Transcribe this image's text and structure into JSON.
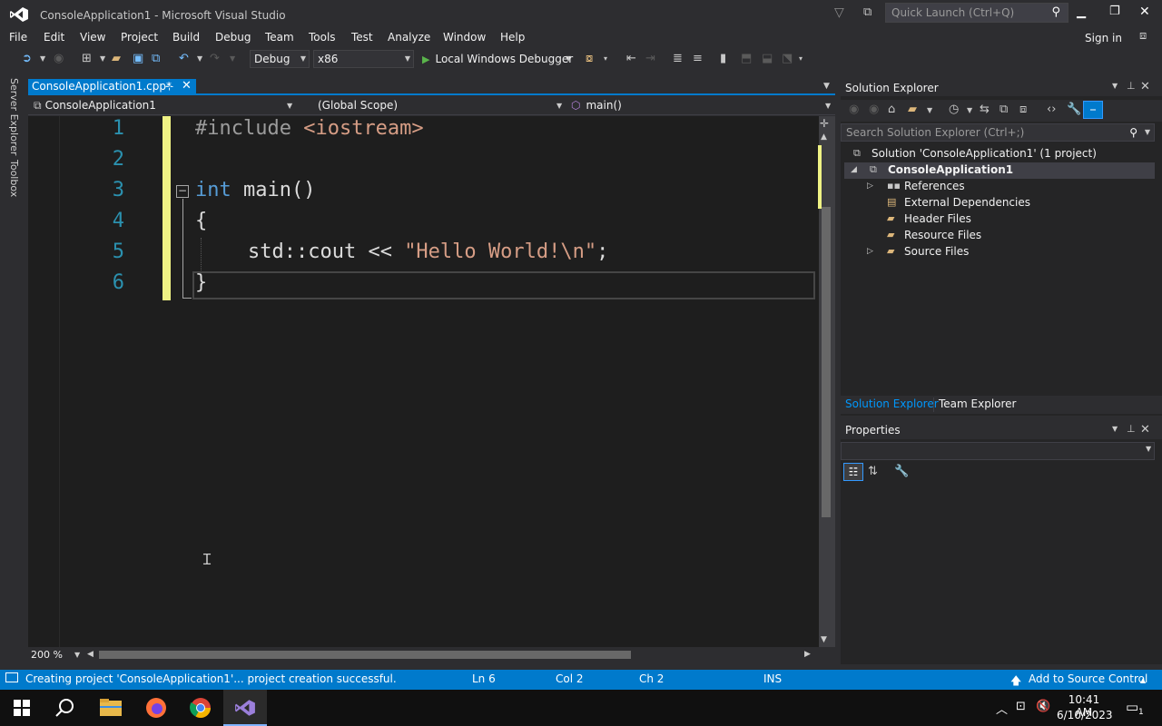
{
  "window": {
    "title": "ConsoleApplication1 - Microsoft Visual Studio",
    "quick_launch_placeholder": "Quick Launch (Ctrl+Q)",
    "sign_in": "Sign in"
  },
  "menu": [
    "File",
    "Edit",
    "View",
    "Project",
    "Build",
    "Debug",
    "Team",
    "Tools",
    "Test",
    "Analyze",
    "Window",
    "Help"
  ],
  "toolbar": {
    "configuration": "Debug",
    "platform": "x86",
    "debugger": "Local Windows Debugger"
  },
  "side_tabs": [
    "Server Explorer",
    "Toolbox"
  ],
  "document_tab": {
    "label": "ConsoleApplication1.cpp*",
    "pin": "⊹",
    "close": "✕"
  },
  "navbar": {
    "project": "ConsoleApplication1",
    "scope": "(Global Scope)",
    "member": "main()"
  },
  "editor": {
    "line_numbers": [
      "1",
      "2",
      "3",
      "4",
      "5",
      "6"
    ],
    "lines": {
      "l1_directive": "#include",
      "l1_header": " <iostream>",
      "l3_keyword": "int",
      "l3_rest": " main()",
      "l4": "{",
      "l5_a": "std::cout << ",
      "l5_str": "\"Hello World!\\n\"",
      "l5_end": ";",
      "l6": "}"
    },
    "zoom": "200 %"
  },
  "solution_explorer": {
    "title": "Solution Explorer",
    "search_placeholder": "Search Solution Explorer (Ctrl+;)",
    "solution": "Solution 'ConsoleApplication1' (1 project)",
    "project": "ConsoleApplication1",
    "nodes": [
      "References",
      "External Dependencies",
      "Header Files",
      "Resource Files",
      "Source Files"
    ]
  },
  "panel_tabs": {
    "solution_explorer": "Solution Explorer",
    "team_explorer": "Team Explorer"
  },
  "properties": {
    "title": "Properties"
  },
  "statusbar": {
    "message": "Creating project 'ConsoleApplication1'... project creation successful.",
    "line": "Ln 6",
    "col": "Col 2",
    "ch": "Ch 2",
    "mode": "INS",
    "source_control": "Add to Source Control"
  },
  "taskbar": {
    "time": "10:41 AM",
    "date": "6/10/2023",
    "notification_count": "1"
  },
  "colors": {
    "accent": "#007acc",
    "changed_line": "#eff284",
    "keyword": "#569cd6",
    "string": "#d69d85",
    "line_number": "#2b91af"
  }
}
